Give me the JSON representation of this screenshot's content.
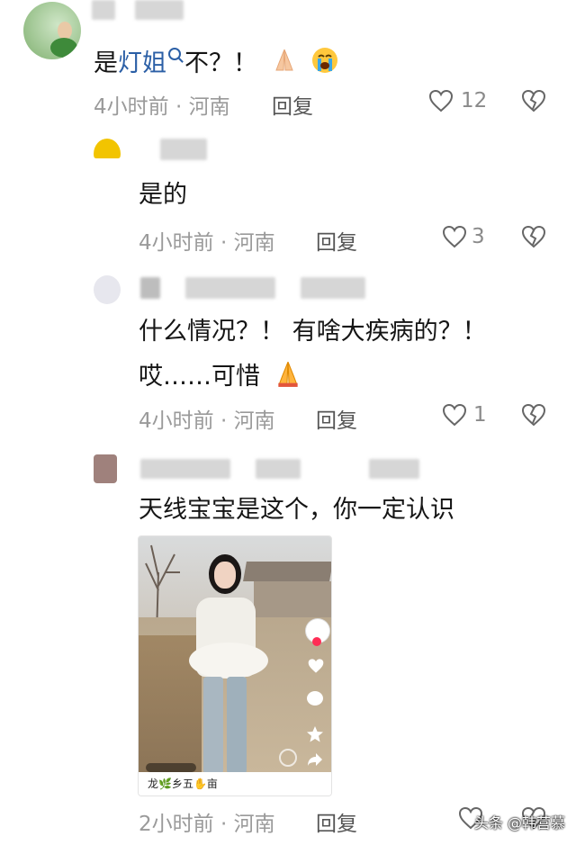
{
  "comments": [
    {
      "text_parts": [
        "是",
        "灯姐",
        "不？！"
      ],
      "time": "4小时前 · 河南",
      "reply": "回复",
      "likes": "12"
    },
    {
      "text": "是的",
      "time": "4小时前 · 河南",
      "reply": "回复",
      "likes": "3"
    },
    {
      "line1": "什么情况？！ 有啥大疾病的？！",
      "line2": "哎……可惜",
      "time": "4小时前 · 河南",
      "reply": "回复",
      "likes": "1"
    },
    {
      "text": "天线宝宝是这个，你一定认识",
      "time": "2小时前 · 河南",
      "reply": "回复",
      "video_footer": "龙🌿乡五✋亩"
    }
  ],
  "watermark": "头条 @韩营慕",
  "icons": {
    "like": "heart-outline-icon",
    "dislike": "broken-heart-icon",
    "search": "search-icon"
  },
  "colors": {
    "highlight": "#2b5fa6",
    "meta": "#9a9a9a"
  }
}
